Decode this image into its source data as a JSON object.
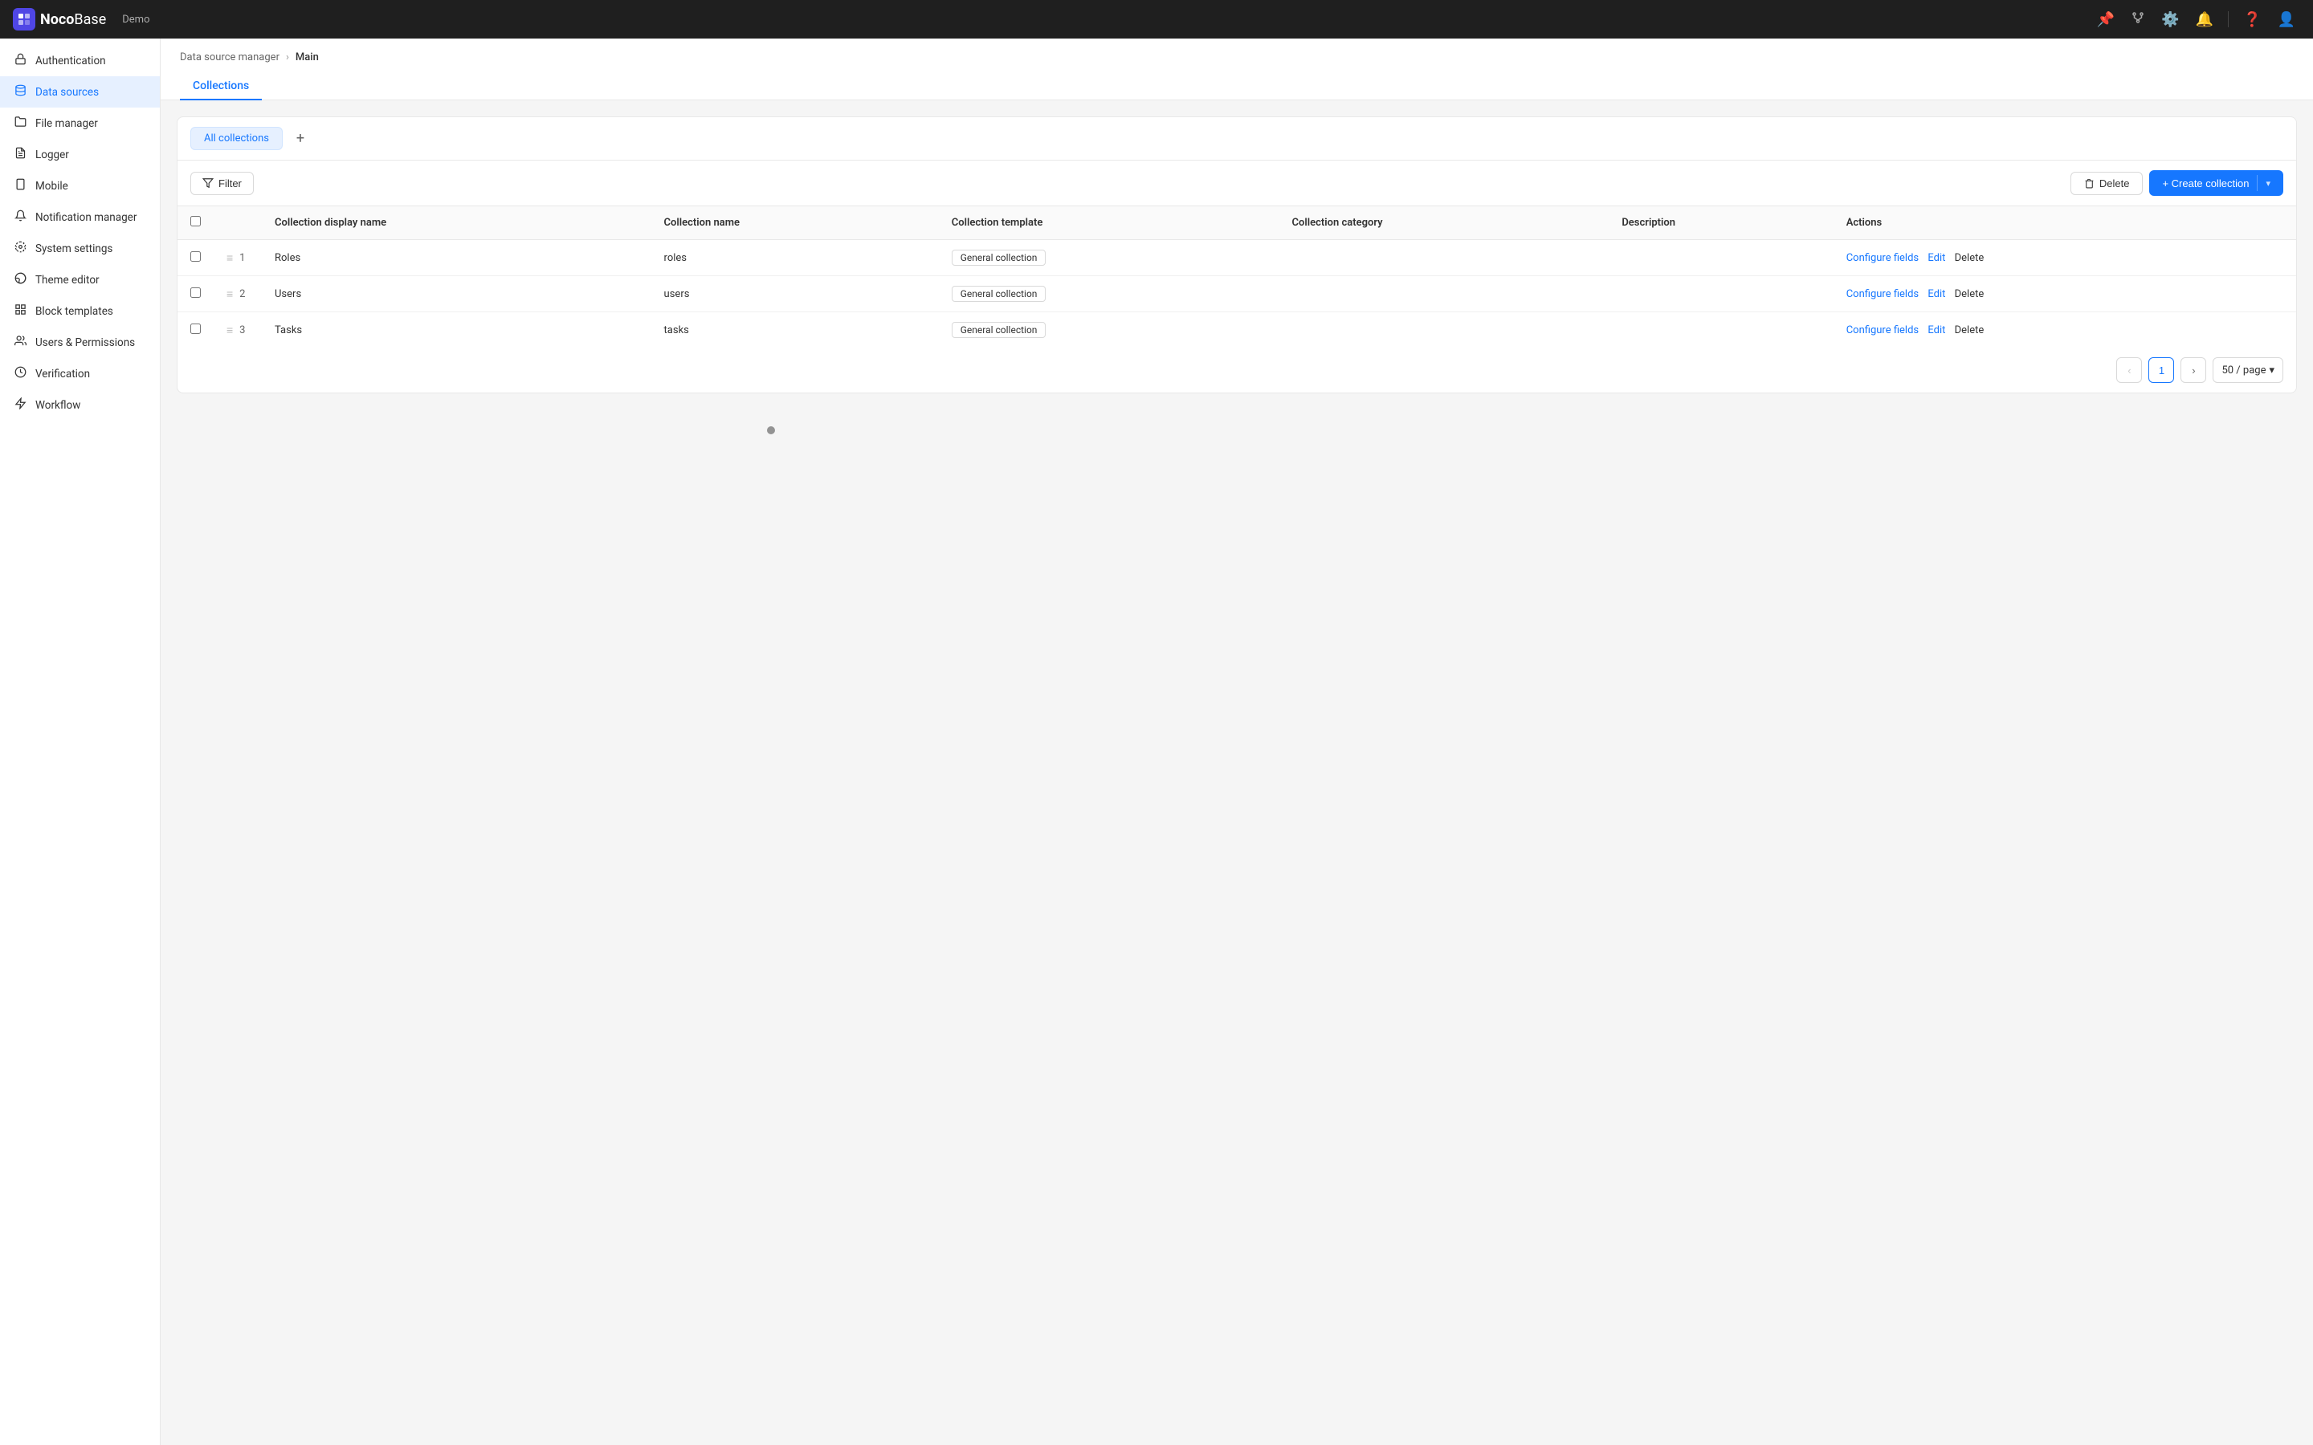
{
  "navbar": {
    "logo_text": "NocoBase",
    "demo_label": "Demo",
    "icons": [
      "pin-icon",
      "branch-icon",
      "settings-icon",
      "bell-icon",
      "help-icon",
      "user-icon"
    ]
  },
  "sidebar": {
    "items": [
      {
        "id": "authentication",
        "label": "Authentication",
        "icon": "🔐"
      },
      {
        "id": "data-sources",
        "label": "Data sources",
        "icon": "🗄️",
        "active": true
      },
      {
        "id": "file-manager",
        "label": "File manager",
        "icon": "📁"
      },
      {
        "id": "logger",
        "label": "Logger",
        "icon": "📋"
      },
      {
        "id": "mobile",
        "label": "Mobile",
        "icon": "📱"
      },
      {
        "id": "notification-manager",
        "label": "Notification manager",
        "icon": "🔔"
      },
      {
        "id": "system-settings",
        "label": "System settings",
        "icon": "⚙️"
      },
      {
        "id": "theme-editor",
        "label": "Theme editor",
        "icon": "🎨"
      },
      {
        "id": "block-templates",
        "label": "Block templates",
        "icon": "🧩"
      },
      {
        "id": "users-permissions",
        "label": "Users & Permissions",
        "icon": "👥"
      },
      {
        "id": "verification",
        "label": "Verification",
        "icon": "✅"
      },
      {
        "id": "workflow",
        "label": "Workflow",
        "icon": "⚡"
      }
    ]
  },
  "breadcrumb": {
    "parent": "Data source manager",
    "current": "Main"
  },
  "tabs": [
    {
      "id": "collections",
      "label": "Collections",
      "active": true
    }
  ],
  "sub_tabs": {
    "all_collections_label": "All collections",
    "add_tooltip": "+"
  },
  "toolbar": {
    "filter_label": "Filter",
    "delete_label": "Delete",
    "create_label": "+ Create collection"
  },
  "table": {
    "columns": [
      {
        "id": "display-name",
        "label": "Collection display name"
      },
      {
        "id": "name",
        "label": "Collection name"
      },
      {
        "id": "template",
        "label": "Collection template"
      },
      {
        "id": "category",
        "label": "Collection category"
      },
      {
        "id": "description",
        "label": "Description"
      },
      {
        "id": "actions",
        "label": "Actions"
      }
    ],
    "rows": [
      {
        "num": "1",
        "display_name": "Roles",
        "name": "roles",
        "template": "General collection",
        "category": "",
        "description": "",
        "actions": {
          "configure": "Configure fields",
          "edit": "Edit",
          "delete": "Delete"
        }
      },
      {
        "num": "2",
        "display_name": "Users",
        "name": "users",
        "template": "General collection",
        "category": "",
        "description": "",
        "actions": {
          "configure": "Configure fields",
          "edit": "Edit",
          "delete": "Delete"
        }
      },
      {
        "num": "3",
        "display_name": "Tasks",
        "name": "tasks",
        "template": "General collection",
        "category": "",
        "description": "",
        "actions": {
          "configure": "Configure fields",
          "edit": "Edit",
          "delete": "Delete"
        }
      }
    ]
  },
  "pagination": {
    "current_page": "1",
    "page_size_label": "50 / page"
  }
}
